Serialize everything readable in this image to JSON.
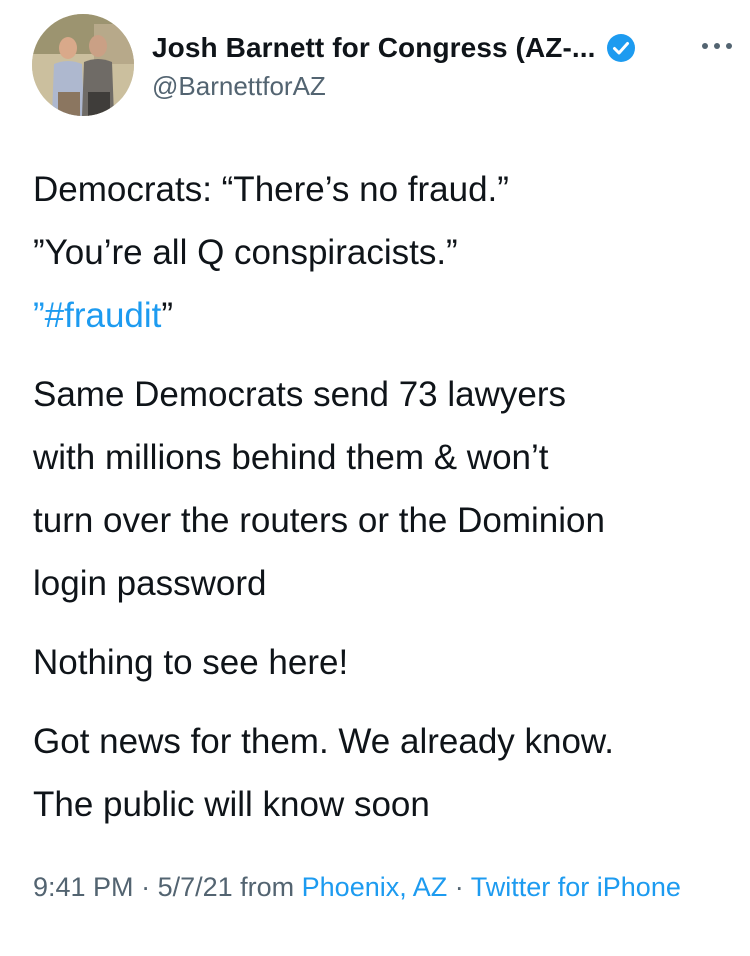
{
  "author": {
    "display_name": "Josh Barnett for Congress (AZ-...",
    "handle": "@BarnettforAZ",
    "verified": true,
    "avatar_icon": "profile-photo-two-men",
    "more_icon": "more-horizontal-icon"
  },
  "tweet": {
    "line1": "Democrats: “There’s no fraud.”",
    "line2": "”You’re all Q conspiracists.”",
    "line3_open": "”",
    "line3_hashtag": "#fraudit",
    "line3_close": "”",
    "para2_line1": "Same Democrats send 73 lawyers",
    "para2_line2": "with millions behind them & won’t",
    "para2_line3": "turn over the routers or the Dominion",
    "para2_line4": "login password",
    "para3": "Nothing to see here!",
    "para4_line1": "Got news for them. We already know.",
    "para4_line2": "The public will know soon"
  },
  "meta": {
    "time": "9:41 PM",
    "sep1": " · ",
    "date": "5/7/21",
    "from": " from ",
    "location": "Phoenix, AZ",
    "sep2": " · ",
    "source": "Twitter for iPhone"
  },
  "colors": {
    "link": "#1d9bf0",
    "text": "#0f1419",
    "secondary": "#536471"
  }
}
